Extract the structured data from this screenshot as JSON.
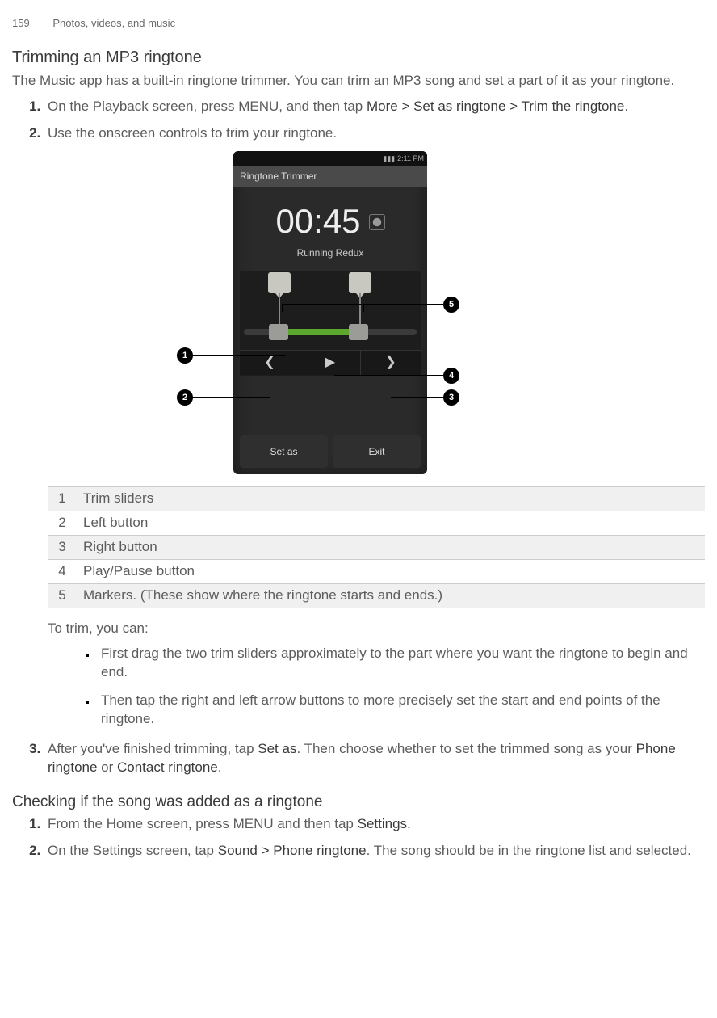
{
  "header": {
    "page_number": "159",
    "chapter": "Photos, videos, and music"
  },
  "main": {
    "title": "Trimming an MP3 ringtone",
    "intro": "The Music app has a built-in ringtone trimmer. You can trim an MP3 song and set a part of it as your ringtone.",
    "steps": {
      "s1_a": "On the Playback screen, press MENU, and then tap ",
      "s1_b": "More > Set as ringtone > Trim the ringtone",
      "s1_c": ".",
      "s2": "Use the onscreen controls to trim your ringtone.",
      "trim_intro": "To trim, you can:",
      "bullets": {
        "b1": "First drag the two trim sliders approximately to the part where you want the ringtone to begin and end.",
        "b2": "Then tap the right and left arrow buttons to more precisely set the start and end points of the ringtone."
      },
      "s3_a": "After you've finished trimming, tap ",
      "s3_b": "Set as",
      "s3_c": ". Then choose whether to set the trimmed song as your ",
      "s3_d": "Phone ringtone",
      "s3_e": " or ",
      "s3_f": "Contact ringtone",
      "s3_g": "."
    },
    "screenshot": {
      "status_time": "2:11 PM",
      "app_title": "Ringtone Trimmer",
      "timer": "00:45",
      "song": "Running Redux",
      "btn_left": "Set as",
      "btn_right": "Exit"
    },
    "legend": {
      "r1_n": "1",
      "r1_t": "Trim sliders",
      "r2_n": "2",
      "r2_t": "Left button",
      "r3_n": "3",
      "r3_t": "Right button",
      "r4_n": "4",
      "r4_t": "Play/Pause button",
      "r5_n": "5",
      "r5_t": "Markers. (These show where the ringtone starts and ends.)"
    },
    "sub_title": "Checking if the song was added as a ringtone",
    "sub_steps": {
      "s1_a": "From the Home screen, press MENU and then tap ",
      "s1_b": "Settings.",
      "s2_a": "On the Settings screen, tap ",
      "s2_b": "Sound > Phone ringtone",
      "s2_c": ". The song should be in the ringtone list and selected."
    }
  }
}
